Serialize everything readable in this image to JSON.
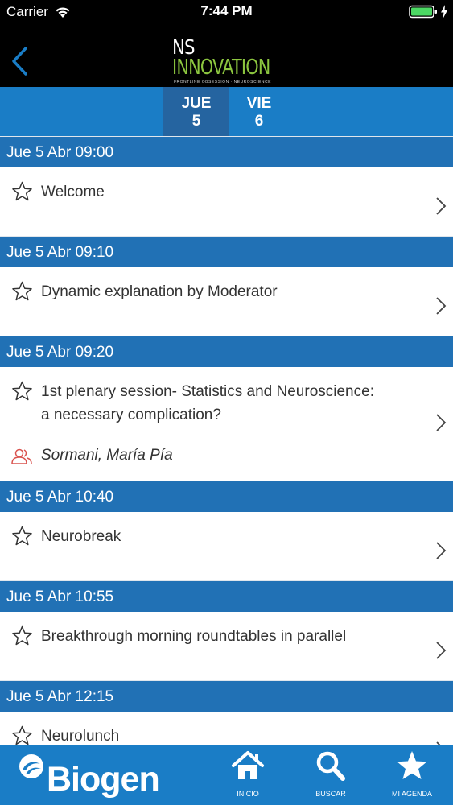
{
  "status_bar": {
    "carrier": "Carrier",
    "time": "7:44 PM"
  },
  "header": {
    "logo_line1": "NS",
    "logo_line2": "INNOVATION",
    "logo_tagline": "FRONTLINE OBSESSION · NEUROSCIENCE",
    "logo_colors": {
      "ns": "#ffffff",
      "innovation": "#8cc63f"
    }
  },
  "day_tabs": [
    {
      "day": "JUE",
      "num": "5",
      "selected": true
    },
    {
      "day": "VIE",
      "num": "6",
      "selected": false
    }
  ],
  "schedule": [
    {
      "time": "Jue 5 Abr 09:00",
      "title_lines": [
        "Welcome"
      ]
    },
    {
      "time": "Jue 5 Abr 09:10",
      "title_lines": [
        "Dynamic explanation by Moderator"
      ]
    },
    {
      "time": "Jue 5 Abr 09:20",
      "title_lines": [
        "1st plenary session- Statistics and Neuroscience:",
        "a necessary complication?"
      ],
      "speaker": "Sormani, María Pía"
    },
    {
      "time": "Jue 5 Abr 10:40",
      "title_lines": [
        "Neurobreak"
      ]
    },
    {
      "time": "Jue 5 Abr 10:55",
      "title_lines": [
        "Breakthrough morning roundtables in parallel"
      ]
    },
    {
      "time": "Jue 5 Abr 12:15",
      "title_lines": [
        "Neurolunch"
      ]
    }
  ],
  "tab_bar": {
    "brand": "Biogen",
    "items": [
      {
        "label": "INICIO",
        "icon": "home-icon"
      },
      {
        "label": "BUSCAR",
        "icon": "search-icon"
      },
      {
        "label": "MI AGENDA",
        "icon": "star-icon"
      }
    ]
  },
  "colors": {
    "accent_blue": "#1a7dc6",
    "header_blue": "#2171b5",
    "selected_tab": "#2564a0",
    "speaker_icon": "#d9534f",
    "battery_green": "#4cd964"
  }
}
